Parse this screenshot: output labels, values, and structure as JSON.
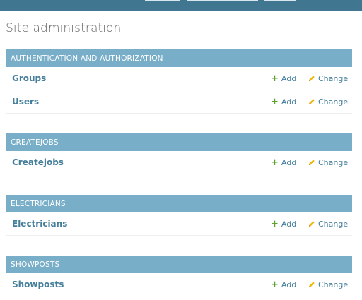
{
  "page_title": "Site administration",
  "colors": {
    "header_bar": "#417690",
    "module_header": "#79aec8",
    "link": "#447e9b",
    "add_icon": "#5ba22b",
    "change_icon": "#efb80b"
  },
  "modules": [
    {
      "title": "Authentication and Authorization",
      "models": [
        {
          "name": "Groups",
          "add": "Add",
          "change": "Change"
        },
        {
          "name": "Users",
          "add": "Add",
          "change": "Change"
        }
      ]
    },
    {
      "title": "Createjobs",
      "models": [
        {
          "name": "Createjobs",
          "add": "Add",
          "change": "Change"
        }
      ]
    },
    {
      "title": "Electricians",
      "models": [
        {
          "name": "Electricians",
          "add": "Add",
          "change": "Change"
        }
      ]
    },
    {
      "title": "Showposts",
      "models": [
        {
          "name": "Showposts",
          "add": "Add",
          "change": "Change"
        }
      ]
    }
  ]
}
